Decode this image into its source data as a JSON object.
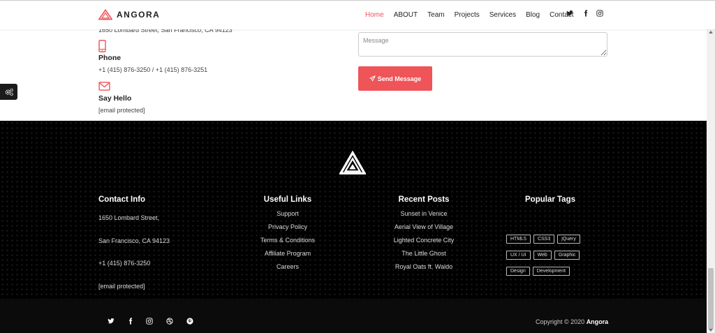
{
  "brand": {
    "name": "ANGORA",
    "accent": "#ef5458"
  },
  "nav": {
    "items": [
      {
        "label": "Home",
        "active": true
      },
      {
        "label": "ABOUT"
      },
      {
        "label": "Team"
      },
      {
        "label": "Projects"
      },
      {
        "label": "Services"
      },
      {
        "label": "Blog"
      },
      {
        "label": "Contact"
      }
    ],
    "social": [
      "twitter-icon",
      "facebook-icon",
      "instagram-icon"
    ]
  },
  "contact": {
    "address": "1650 Lombard Street, San Francisco, CA 94123",
    "phone_label": "Phone",
    "phone_value": "+1 (415) 876-3250 / +1 (415) 876-3251",
    "hello_label": "Say Hello",
    "hello_value": "[email protected]"
  },
  "form": {
    "message_placeholder": "Message",
    "send_label": "Send Message"
  },
  "footer": {
    "contact_info": {
      "title": "Contact Info",
      "line1": "1650 Lombard Street,",
      "line2": "San Francisco, CA 94123",
      "phone": "+1 (415) 876-3250",
      "email": "[email protected]"
    },
    "useful_links": {
      "title": "Useful Links",
      "items": [
        "Support",
        "Privacy Policy",
        "Terms & Conditions",
        "Affiliate Program",
        "Careers"
      ]
    },
    "recent_posts": {
      "title": "Recent Posts",
      "items": [
        "Sunset in Venice",
        "Aerial View of Village",
        "Lighted Concrete City",
        "The Little Ghost",
        "Royal Oats ft. Waldo"
      ]
    },
    "popular_tags": {
      "title": "Popular Tags",
      "items": [
        "HTML5",
        "CSS3",
        "jQuery",
        "UX / UI",
        "Web",
        "Graphic",
        "Design",
        "Development"
      ]
    }
  },
  "bottom": {
    "social": [
      "twitter-icon",
      "facebook-icon",
      "instagram-icon",
      "dribbble-icon",
      "pinterest-icon"
    ],
    "copyright": "Copyright © 2020",
    "copyright_brand": "Angora"
  }
}
